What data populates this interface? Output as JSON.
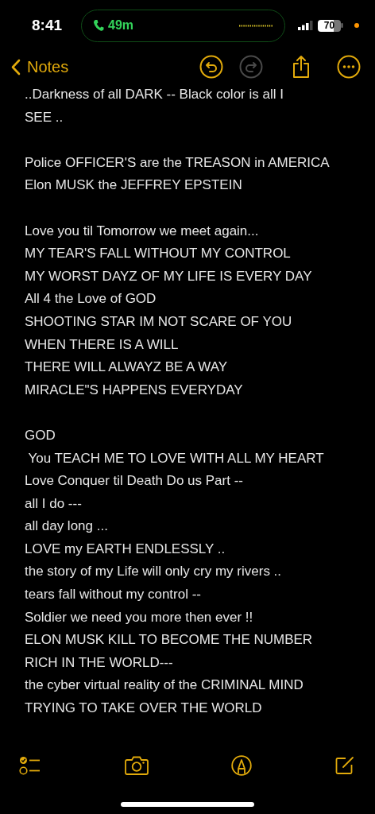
{
  "status_bar": {
    "time": "8:41",
    "call_duration": "49m",
    "battery": "70"
  },
  "nav": {
    "back_label": "Notes",
    "actions": [
      {
        "kind": "undo",
        "disabled": false
      },
      {
        "kind": "redo",
        "disabled": true
      },
      {
        "kind": "share",
        "disabled": false
      },
      {
        "kind": "more",
        "disabled": false
      }
    ]
  },
  "note": {
    "paragraphs": [
      {
        "lines": [
          "..Darkness of all DARK -- Black color is all I",
          "SEE .."
        ]
      },
      {
        "lines": [
          "Police OFFICER'S are the TREASON in AMERICA",
          "Elon MUSK the JEFFREY EPSTEIN"
        ]
      },
      {
        "lines": [
          "Love you til Tomorrow we meet again...",
          "MY TEAR'S FALL WITHOUT MY CONTROL",
          "MY WORST DAYZ OF MY LIFE IS EVERY DAY",
          "All 4 the Love of GOD",
          "SHOOTING STAR IM NOT SCARE OF YOU",
          "WHEN THERE IS A WILL",
          "THERE WILL ALWAYZ BE A WAY",
          "MIRACLE\"S HAPPENS EVERYDAY"
        ]
      },
      {
        "lines": [
          "GOD",
          " You TEACH ME TO LOVE WITH ALL MY HEART",
          "Love Conquer til Death Do us Part --",
          "all I do ---",
          "all day long ...",
          "LOVE my EARTH ENDLESSLY ..",
          "the story of my Life will only cry my rivers ..",
          "tears fall without my control --",
          "Soldier we need you more then ever !!",
          "ELON MUSK KILL TO BECOME THE NUMBER",
          "RICH IN THE WORLD---",
          "the cyber virtual reality of the CRIMINAL MIND",
          "TRYING TO TAKE OVER THE WORLD"
        ]
      }
    ]
  },
  "toolbar": {
    "items": [
      {
        "kind": "checklist"
      },
      {
        "kind": "camera"
      },
      {
        "kind": "markup"
      },
      {
        "kind": "compose"
      }
    ]
  }
}
